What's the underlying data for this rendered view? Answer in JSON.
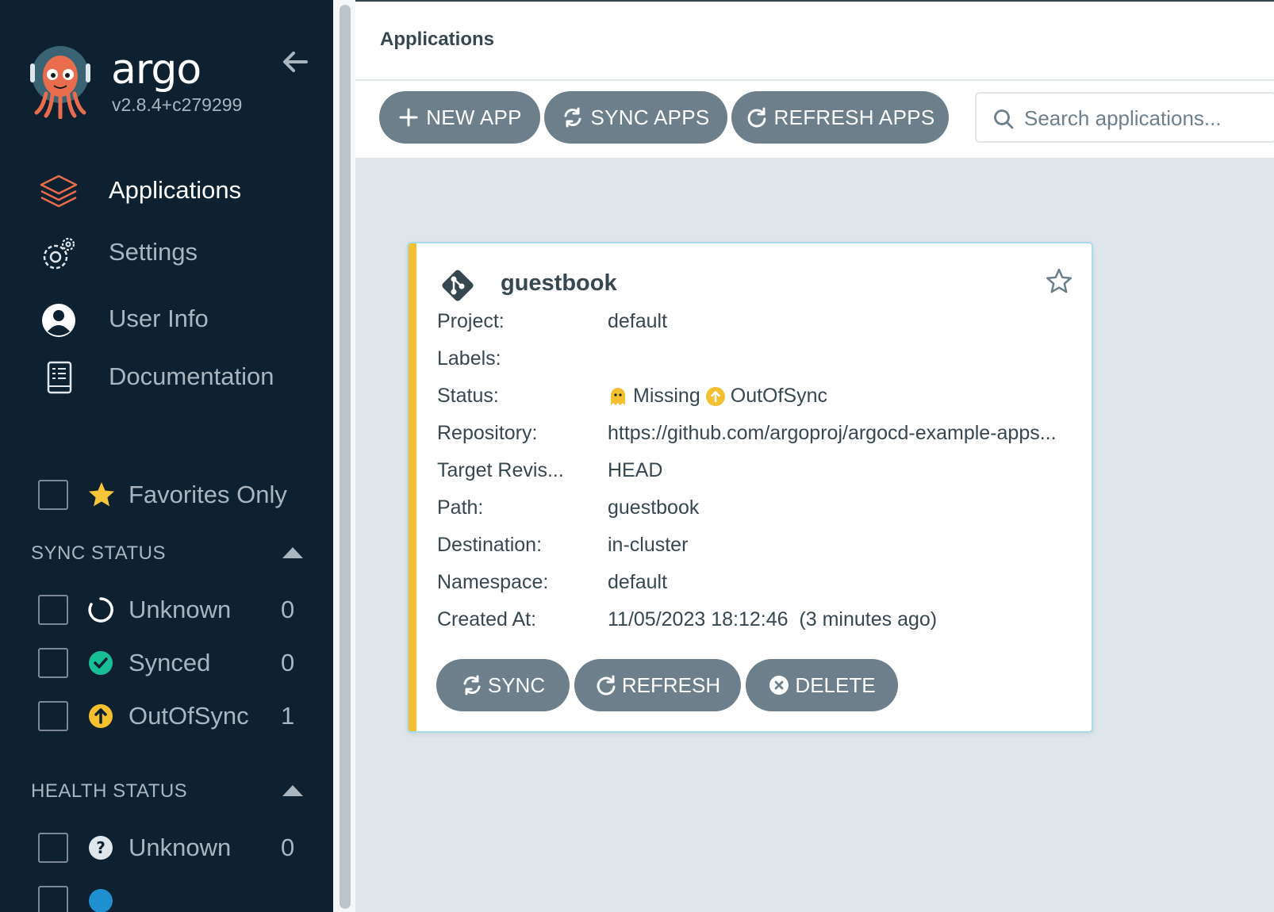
{
  "sidebar": {
    "brand": "argo",
    "version": "v2.8.4+c279299",
    "nav": [
      {
        "label": "Applications"
      },
      {
        "label": "Settings"
      },
      {
        "label": "User Info"
      },
      {
        "label": "Documentation"
      }
    ],
    "favorites_label": "Favorites Only",
    "sync_status": {
      "title": "SYNC STATUS",
      "items": [
        {
          "label": "Unknown",
          "count": "0"
        },
        {
          "label": "Synced",
          "count": "0"
        },
        {
          "label": "OutOfSync",
          "count": "1"
        }
      ]
    },
    "health_status": {
      "title": "HEALTH STATUS",
      "items": [
        {
          "label": "Unknown",
          "count": "0"
        }
      ]
    }
  },
  "header": {
    "title": "Applications"
  },
  "toolbar": {
    "new_app": "NEW APP",
    "sync_apps": "SYNC APPS",
    "refresh_apps": "REFRESH APPS",
    "search_placeholder": "Search applications..."
  },
  "app_card": {
    "name": "guestbook",
    "fields": {
      "project": {
        "key": "Project:",
        "value": "default"
      },
      "labels": {
        "key": "Labels:",
        "value": ""
      },
      "status": {
        "key": "Status:",
        "health": "Missing",
        "sync": "OutOfSync"
      },
      "repository": {
        "key": "Repository:",
        "value": "https://github.com/argoproj/argocd-example-apps..."
      },
      "target_revision": {
        "key": "Target Revis...",
        "value": "HEAD"
      },
      "path": {
        "key": "Path:",
        "value": "guestbook"
      },
      "destination": {
        "key": "Destination:",
        "value": "in-cluster"
      },
      "namespace": {
        "key": "Namespace:",
        "value": "default"
      },
      "created_at": {
        "key": "Created At:",
        "value": "11/05/2023 18:12:46  (3 minutes ago)"
      }
    },
    "buttons": {
      "sync": "SYNC",
      "refresh": "REFRESH",
      "delete": "DELETE"
    }
  },
  "colors": {
    "sidebar_bg": "#0e2130",
    "accent_orange": "#e96d4c",
    "button_gray": "#6d7f8b",
    "out_of_sync": "#f4c030",
    "synced": "#18be94",
    "card_border": "#a8dbe9"
  }
}
